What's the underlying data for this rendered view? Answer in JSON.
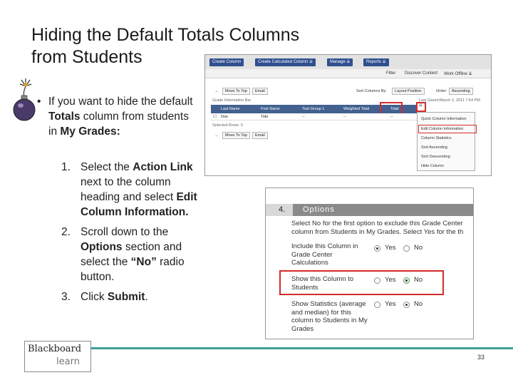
{
  "slide": {
    "title_line1": "Hiding the Default Totals Columns",
    "title_line2": "from Students",
    "bullet_marker": "•",
    "page_number": "33"
  },
  "bullet": {
    "seg1": "If you want to hide the default ",
    "bold1": "Totals",
    "seg2": " column from students in ",
    "bold2": "My Grades:"
  },
  "steps": [
    {
      "num": "1.",
      "pre": "Select the ",
      "bold1": "Action Link",
      "mid": " next to the column heading and select ",
      "bold2": "Edit Column Information."
    },
    {
      "num": "2.",
      "pre": "Scroll down to the ",
      "bold1": "Options",
      "mid": " section and select the ",
      "bold2": "“No”",
      "post": " radio button."
    },
    {
      "num": "3.",
      "pre": "Click ",
      "bold1": "Submit",
      "post": "."
    }
  ],
  "shot1": {
    "toolbar": [
      "Create Column",
      "Create Calculated Column  ⇊",
      "Manage  ⇊",
      "Reports  ⇊"
    ],
    "secondary": [
      "Filter",
      "Discover Content",
      "Work Offline  ⇊"
    ],
    "move_to_top": "Move To Top",
    "email": "Email",
    "sort_columns_by": "Sort Columns By:",
    "layout_position": "Layout Position",
    "order": "Order:",
    "ascending": "Ascending",
    "grade_info_bar": "Grade Information Bar",
    "last_saved": "Last Saved:March 2, 2011 7:54 PM",
    "headers": [
      "Last Name",
      "First Name",
      "Test Group 1",
      "Weighted Total",
      "Total"
    ],
    "row": {
      "last": "Doe",
      "first": "Tobi",
      "c3": "--",
      "c4": "--",
      "c5": "--"
    },
    "selected_rows": "Selected Rows: 0",
    "menu_items": [
      "Quick Column Information",
      "Edit Column Information",
      "Column Statistics",
      "Sort Ascending",
      "Sort Descending",
      "Hide Column"
    ]
  },
  "shot2": {
    "number": "4.",
    "section_title": "Options",
    "desc_line1": "Select No for the first option to exclude this Grade Center",
    "desc_line2": "column from Students in My Grades. Select Yes for the th",
    "opt1": [
      "Include this Column in",
      "Grade Center",
      "Calculations"
    ],
    "opt2": [
      "Show this Column to",
      "Students"
    ],
    "opt3": [
      "Show Statistics (average",
      "and median) for this",
      "column to Students in My",
      "Grades"
    ],
    "yes": "Yes",
    "no": "No"
  },
  "logo": {
    "line1": "Blackboard",
    "line2": "learn"
  }
}
